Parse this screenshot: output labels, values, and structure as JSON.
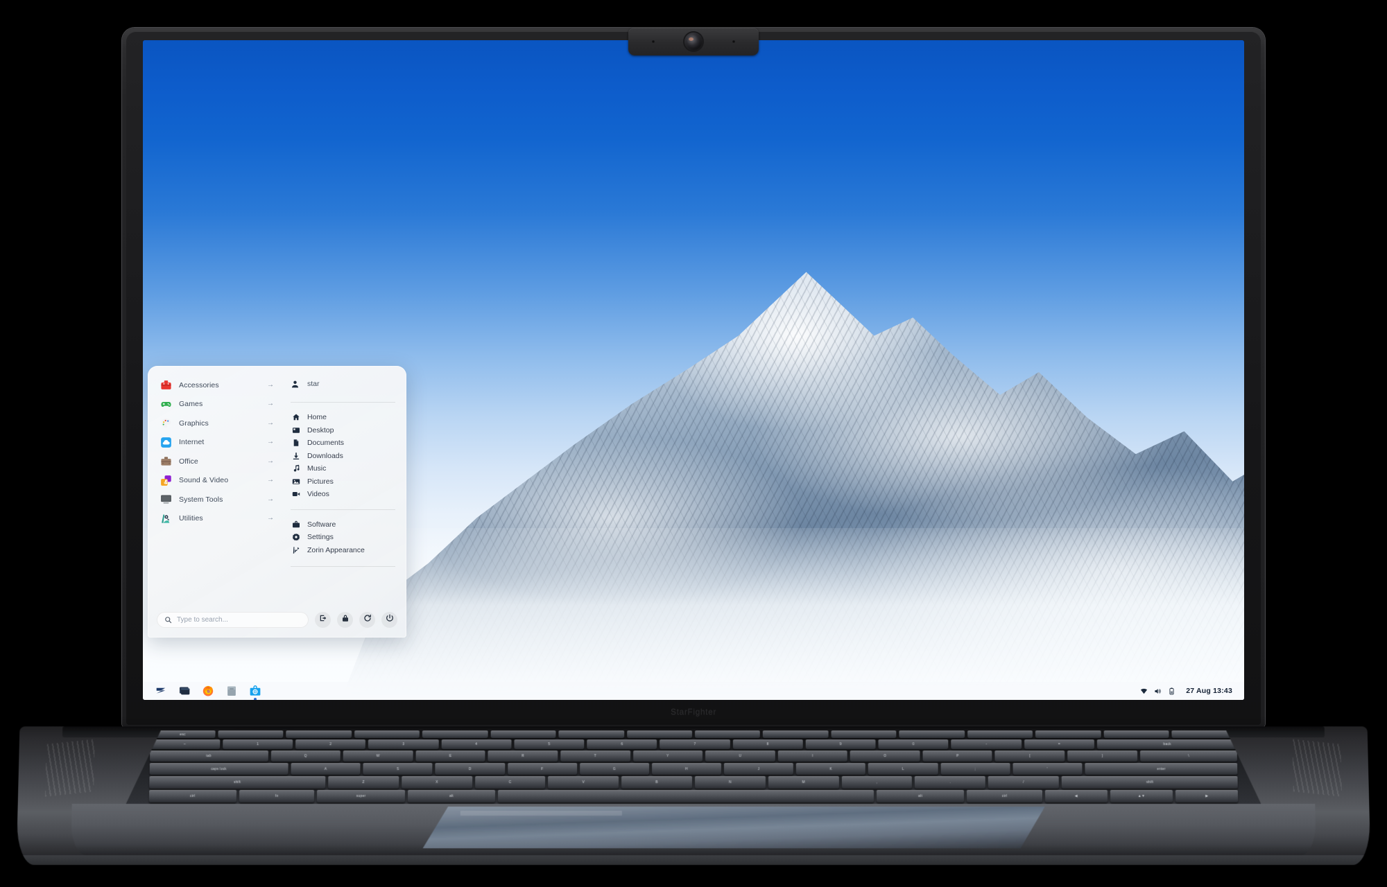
{
  "device": {
    "brand_label": "StarFighter",
    "webcam_icon": "camera-lens-icon"
  },
  "desktop": {
    "wallpaper_description": "Snow-capped mountain peak under blue sky"
  },
  "menu": {
    "categories": [
      {
        "label": "Accessories",
        "icon": "toolbox-icon",
        "arrow": "→"
      },
      {
        "label": "Games",
        "icon": "gamepad-icon",
        "arrow": "→"
      },
      {
        "label": "Graphics",
        "icon": "palette-icon",
        "arrow": "→"
      },
      {
        "label": "Internet",
        "icon": "cloud-icon",
        "arrow": "→"
      },
      {
        "label": "Office",
        "icon": "briefcase-icon",
        "arrow": "→"
      },
      {
        "label": "Sound & Video",
        "icon": "music-video-icon",
        "arrow": "→"
      },
      {
        "label": "System Tools",
        "icon": "monitor-icon",
        "arrow": "→"
      },
      {
        "label": "Utilities",
        "icon": "utilities-icon",
        "arrow": "→"
      }
    ],
    "user": {
      "name": "star",
      "icon": "user-avatar-icon"
    },
    "places": [
      {
        "label": "Home",
        "icon": "home-icon"
      },
      {
        "label": "Desktop",
        "icon": "desktop-icon"
      },
      {
        "label": "Documents",
        "icon": "document-icon"
      },
      {
        "label": "Downloads",
        "icon": "download-icon"
      },
      {
        "label": "Music",
        "icon": "music-note-icon"
      },
      {
        "label": "Pictures",
        "icon": "picture-icon"
      },
      {
        "label": "Videos",
        "icon": "video-camera-icon"
      }
    ],
    "system": [
      {
        "label": "Software",
        "icon": "software-bag-icon"
      },
      {
        "label": "Settings",
        "icon": "gear-icon"
      },
      {
        "label": "Zorin Appearance",
        "icon": "appearance-icon"
      }
    ],
    "search": {
      "placeholder": "Type to search...",
      "value": "",
      "icon": "search-icon"
    },
    "session_buttons": [
      {
        "name": "log-out-button",
        "icon": "logout-icon"
      },
      {
        "name": "lock-button",
        "icon": "lock-icon"
      },
      {
        "name": "restart-button",
        "icon": "restart-icon"
      },
      {
        "name": "power-button",
        "icon": "power-icon"
      }
    ]
  },
  "taskbar": {
    "items": [
      {
        "name": "zorin-menu-button",
        "icon": "zorin-logo-icon"
      },
      {
        "name": "taskview-button",
        "icon": "window-stack-icon"
      },
      {
        "name": "firefox-button",
        "icon": "firefox-icon"
      },
      {
        "name": "files-button",
        "icon": "file-manager-icon"
      },
      {
        "name": "software-button",
        "icon": "software-store-icon",
        "active": true
      }
    ],
    "tray": [
      {
        "name": "network-icon",
        "icon": "wifi-icon"
      },
      {
        "name": "volume-icon",
        "icon": "speaker-icon"
      },
      {
        "name": "battery-icon",
        "icon": "battery-icon"
      }
    ],
    "clock": "27 Aug  13:43"
  },
  "keyboard": {
    "row_fn": [
      "esc",
      "",
      "",
      "",
      "",
      "",
      "",
      "",
      "",
      "",
      "",
      "",
      "",
      "",
      "",
      ""
    ],
    "row_num": [
      "~",
      "1",
      "2",
      "3",
      "4",
      "5",
      "6",
      "7",
      "8",
      "9",
      "0",
      "-",
      "=",
      "back"
    ],
    "row_tab": [
      "tab",
      "Q",
      "W",
      "E",
      "R",
      "T",
      "Y",
      "U",
      "I",
      "O",
      "P",
      "[",
      "]",
      "\\"
    ],
    "row_caps": [
      "caps lock",
      "A",
      "S",
      "D",
      "F",
      "G",
      "H",
      "J",
      "K",
      "L",
      ";",
      "'",
      "enter"
    ],
    "row_shift": [
      "shift",
      "Z",
      "X",
      "C",
      "V",
      "B",
      "N",
      "M",
      ",",
      ".",
      "/",
      "shift"
    ],
    "row_ctrl": [
      "ctrl",
      "fn",
      "super",
      "alt",
      "",
      "alt",
      "ctrl",
      "◀",
      "▲▼",
      "▶"
    ]
  },
  "colors": {
    "accent": "#2e6fd4",
    "sky_top": "#0a55c1",
    "menu_bg": "#f5f7f9",
    "text": "#39414f"
  }
}
